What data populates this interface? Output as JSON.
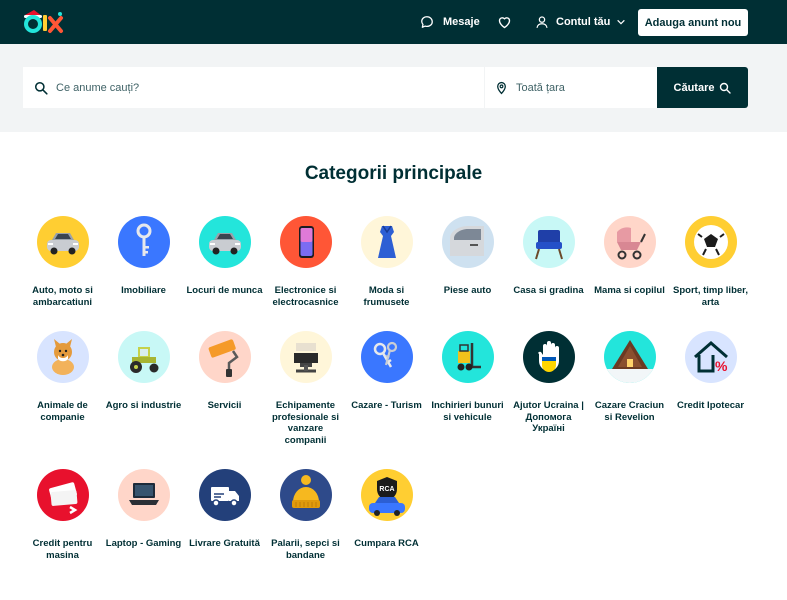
{
  "header": {
    "messages_label": "Mesaje",
    "account_label": "Contul tău",
    "post_ad_label": "Adauga anunt nou"
  },
  "search": {
    "query_placeholder": "Ce anume cauți?",
    "location_placeholder": "Toată țara",
    "button_label": "Căutare"
  },
  "categories_title": "Categorii principale",
  "categories": [
    {
      "label": "Auto, moto si ambarcatiuni",
      "icon": "car-icon",
      "bg": "#ffce32"
    },
    {
      "label": "Imobiliare",
      "icon": "key-icon",
      "bg": "#3a77ff"
    },
    {
      "label": "Locuri de munca",
      "icon": "car-icon",
      "bg": "#23e5db"
    },
    {
      "label": "Electronice si electrocasnice",
      "icon": "phone-icon",
      "bg": "#ff5636"
    },
    {
      "label": "Moda si frumusete",
      "icon": "dress-icon",
      "bg": "#fff6d9"
    },
    {
      "label": "Piese auto",
      "icon": "car-door-icon",
      "bg": "#cee1f0"
    },
    {
      "label": "Casa si gradina",
      "icon": "chair-icon",
      "bg": "#c8f8f6"
    },
    {
      "label": "Mama si copilul",
      "icon": "stroller-icon",
      "bg": "#ffd6c9"
    },
    {
      "label": "Sport, timp liber, arta",
      "icon": "ball-icon",
      "bg": "#ffce32"
    },
    {
      "label": "Animale de companie",
      "icon": "dog-icon",
      "bg": "#d8e4ff"
    },
    {
      "label": "Agro si industrie",
      "icon": "tractor-icon",
      "bg": "#c8f8f6"
    },
    {
      "label": "Servicii",
      "icon": "paint-roller-icon",
      "bg": "#ffd6c9"
    },
    {
      "label": "Echipamente profesionale si vanzare companii",
      "icon": "salon-chair-icon",
      "bg": "#fff6d9"
    },
    {
      "label": "Cazare - Turism",
      "icon": "keys-icon",
      "bg": "#3a77ff"
    },
    {
      "label": "Inchirieri bunuri si vehicule",
      "icon": "forklift-icon",
      "bg": "#23e5db"
    },
    {
      "label": "Ajutor Ucraina | Допомога Україні",
      "icon": "hand-icon",
      "bg": "#002f34"
    },
    {
      "label": "Cazare Craciun si Revelion",
      "icon": "cabin-icon",
      "bg": "#23e5db"
    },
    {
      "label": "Credit Ipotecar",
      "icon": "house-percent-icon",
      "bg": "#d8e4ff"
    },
    {
      "label": "Credit pentru masina",
      "icon": "money-icon",
      "bg": "#e8112d"
    },
    {
      "label": "Laptop - Gaming",
      "icon": "laptop-icon",
      "bg": "#ffd6c9"
    },
    {
      "label": "Livrare Gratuită",
      "icon": "delivery-truck-icon",
      "bg": "#23407a"
    },
    {
      "label": "Palarii, sepci si bandane",
      "icon": "beanie-icon",
      "bg": "#2e4a8a"
    },
    {
      "label": "Cumpara RCA",
      "icon": "rca-car-icon",
      "bg": "#ffce32"
    }
  ]
}
